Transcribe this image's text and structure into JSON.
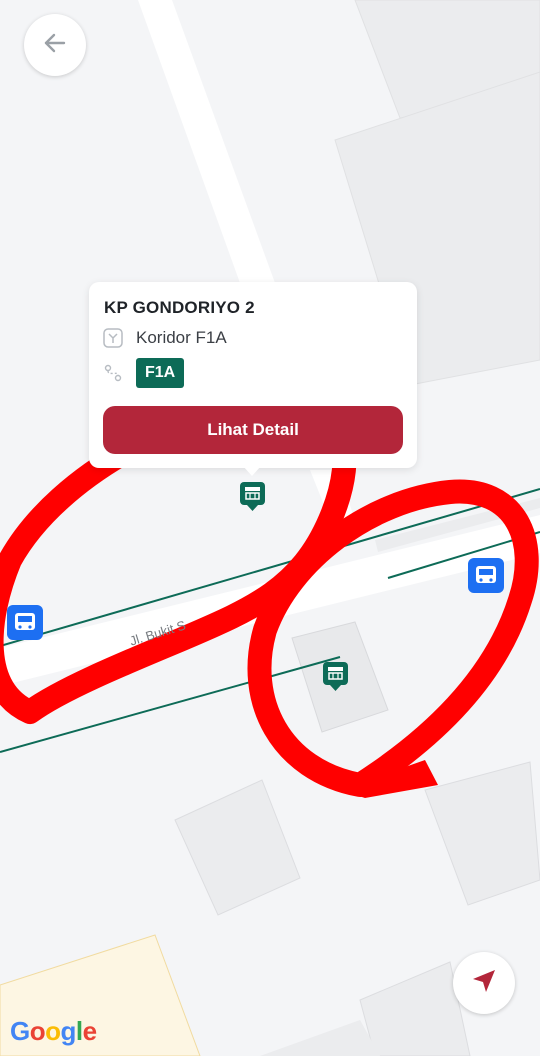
{
  "navigation": {
    "back_icon": "arrow-left-icon",
    "locate_icon": "navigation-arrow-icon"
  },
  "popup": {
    "stop_name": "KP GONDORIYO 2",
    "corridor_label": "Koridor F1A",
    "route_badge": "F1A",
    "detail_button": "Lihat Detail",
    "corridor_icon": "corridor-icon",
    "route_icon": "route-icon"
  },
  "map": {
    "street_name": "Jl. Bukit S",
    "attribution": "Google",
    "markers": [
      {
        "type": "bus-stop",
        "icon": "bus-stop-icon"
      },
      {
        "type": "bus-stop",
        "icon": "bus-stop-icon"
      },
      {
        "type": "bus",
        "icon": "bus-icon"
      },
      {
        "type": "bus",
        "icon": "bus-icon"
      }
    ]
  },
  "colors": {
    "accent_red": "#b3263a",
    "route_green": "#0d6b57",
    "bus_blue": "#1d6ff2",
    "annotation_red": "#ff0000"
  }
}
